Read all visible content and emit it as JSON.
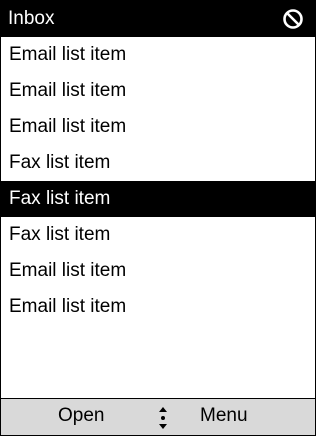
{
  "header": {
    "title": "Inbox",
    "status_icon": "no-entry-icon"
  },
  "list": {
    "items": [
      {
        "label": "Email list item",
        "selected": false
      },
      {
        "label": "Email list item",
        "selected": false
      },
      {
        "label": "Email list item",
        "selected": false
      },
      {
        "label": "Fax list item",
        "selected": false
      },
      {
        "label": "Fax list item",
        "selected": true
      },
      {
        "label": "Fax list item",
        "selected": false
      },
      {
        "label": "Email list item",
        "selected": false
      },
      {
        "label": "Email list item",
        "selected": false
      }
    ]
  },
  "softkeys": {
    "left_label": "Open",
    "right_label": "Menu",
    "center_icon": "scroll-up-down-icon"
  },
  "colors": {
    "header_background": "#000000",
    "selection_background": "#000000",
    "softkey_bar_background": "#d9d9d9"
  }
}
